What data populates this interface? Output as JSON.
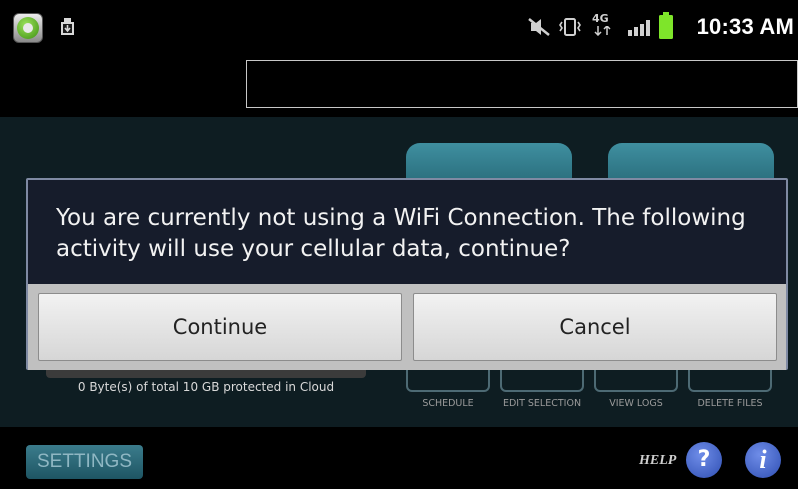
{
  "status_bar": {
    "time": "10:33 AM",
    "network_label": "4G",
    "icons": [
      "app-icon",
      "download-icon",
      "mute-icon",
      "vibrate-icon",
      "network-4g-icon",
      "signal-icon",
      "battery-icon"
    ]
  },
  "app": {
    "storage_text": "0 Byte(s) of total 10 GB protected in Cloud",
    "actions": [
      "SCHEDULE",
      "EDIT SELECTION",
      "VIEW LOGS",
      "DELETE FILES"
    ],
    "settings_label": "SETTINGS",
    "help_label": "HELP",
    "help_icon_glyph": "?",
    "info_icon_glyph": "i"
  },
  "dialog": {
    "message": "You are currently not using a WiFi Connection. The following activity will use your cellular data, continue?",
    "continue_label": "Continue",
    "cancel_label": "Cancel"
  },
  "colors": {
    "dialog_bg": "#161c2b",
    "button_bar": "#c0c0c0",
    "accent_teal": "#2e7383",
    "battery_green": "#7ee52a"
  }
}
